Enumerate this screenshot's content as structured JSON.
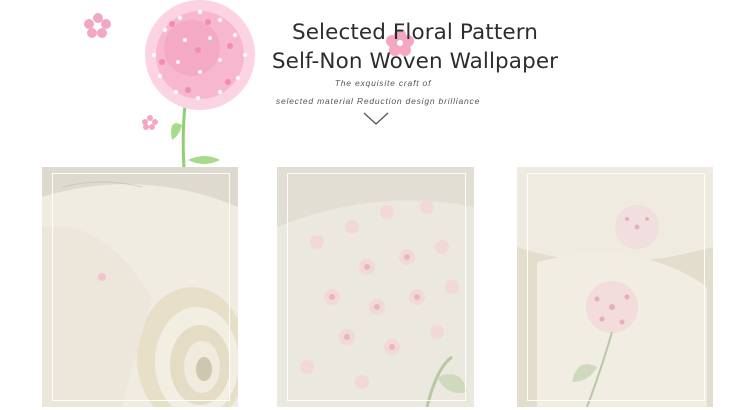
{
  "header": {
    "title_line1": "Selected Floral Pattern",
    "title_line2": "Self-Non Woven Wallpaper",
    "subtitle_line1": "The exquisite craft of",
    "subtitle_line2": "selected  material Reduction design brilliance"
  },
  "icons": {
    "flower": "dandelion-flower-illustration",
    "scroll_hint": "chevron-down-icon"
  },
  "colors": {
    "petal_pink": "#f3a7c3",
    "stem_green": "#8fcf73",
    "wallpaper_cream": "#efebe0"
  }
}
